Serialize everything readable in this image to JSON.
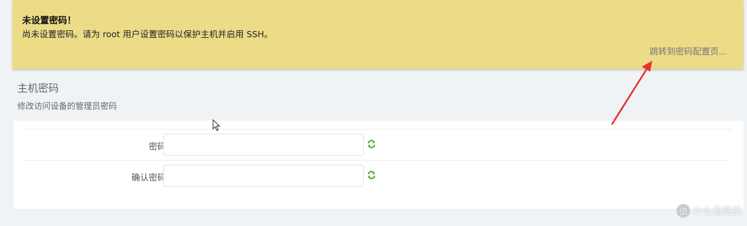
{
  "alert": {
    "title": "未设置密码！",
    "text": "尚未设置密码。请为 root 用户设置密码以保护主机并启用 SSH。",
    "link": "跳转到密码配置页..."
  },
  "section": {
    "title": "主机密码",
    "description": "修改访问设备的管理员密码"
  },
  "form": {
    "password_label": "密码",
    "confirm_label": "确认密码",
    "password_value": "",
    "confirm_value": ""
  },
  "watermark": {
    "logo_char": "值",
    "text": "什么值得买"
  },
  "colors": {
    "alert_bg": "#ecdc88",
    "page_bg": "#f0f3f5",
    "arrow": "#e8332b",
    "reveal_icon": "#5aa02c"
  }
}
